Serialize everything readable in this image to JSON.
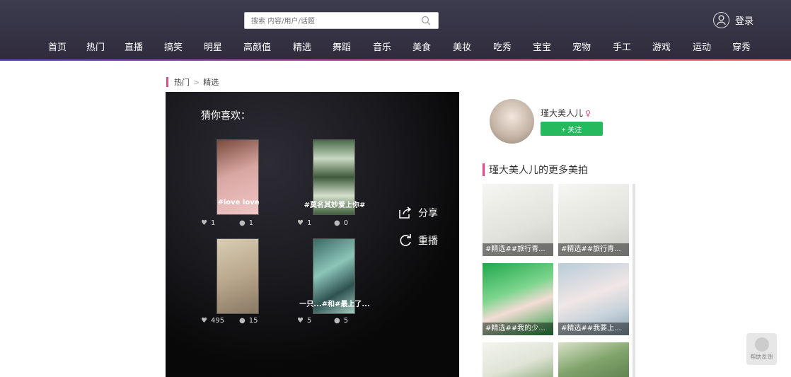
{
  "search": {
    "placeholder": "搜索 内容/用户/话题"
  },
  "header": {
    "login_label": "登录"
  },
  "nav": [
    "首页",
    "热门",
    "直播",
    "搞笑",
    "明星",
    "高颜值",
    "精选",
    "舞蹈",
    "音乐",
    "美食",
    "美妆",
    "吃秀",
    "宝宝",
    "宠物",
    "手工",
    "游戏",
    "运动",
    "穿秀"
  ],
  "breadcrumb": {
    "parent": "热门",
    "separator": ">",
    "current": "精选"
  },
  "player": {
    "guess_title": "猜你喜欢：",
    "items": [
      {
        "label": "#love love",
        "likes": "1",
        "comments": "1"
      },
      {
        "label": "#莫名其妙爱上你#",
        "likes": "1",
        "comments": "0"
      },
      {
        "label": "",
        "likes": "495",
        "comments": "15"
      },
      {
        "label": "一只...#和#最上了...",
        "likes": "5",
        "comments": "5"
      }
    ],
    "share_label": "分享",
    "replay_label": "重播"
  },
  "profile": {
    "name": "瑾大美人儿",
    "follow_label": "+ 关注"
  },
  "more": {
    "title": "瑾大美人儿的更多美拍",
    "items": [
      {
        "caption": "#精选##旅行青..."
      },
      {
        "caption": "#精选##旅行青..."
      },
      {
        "caption": "#精选##我的少..."
      },
      {
        "caption": "#精选##我要上..."
      },
      {
        "caption": ""
      },
      {
        "caption": ""
      }
    ]
  },
  "help": {
    "label": "帮助反馈"
  }
}
